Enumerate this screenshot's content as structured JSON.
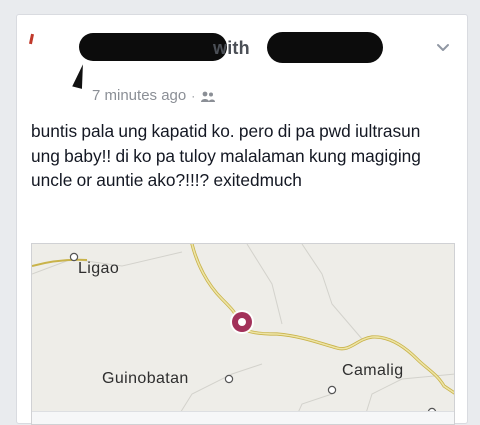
{
  "post": {
    "with_label": "with",
    "timestamp": "7 minutes ago",
    "separator": "·",
    "audience_icon": "friends-icon",
    "options_icon": "chevron-down-icon",
    "text": "buntis pala ung kapatid ko. pero di pa pwd iultrasun ung baby!! di ko pa tuloy malalaman kung magiging uncle or auntie ako?!!!? exitedmuch"
  },
  "map": {
    "places": {
      "ligao": "Ligao",
      "guinobatan": "Guinobatan",
      "camalig": "Camalig"
    },
    "pin_icon": "location-pin-icon",
    "road_color": "#e8d98a",
    "pin_color": "#a2315a"
  }
}
